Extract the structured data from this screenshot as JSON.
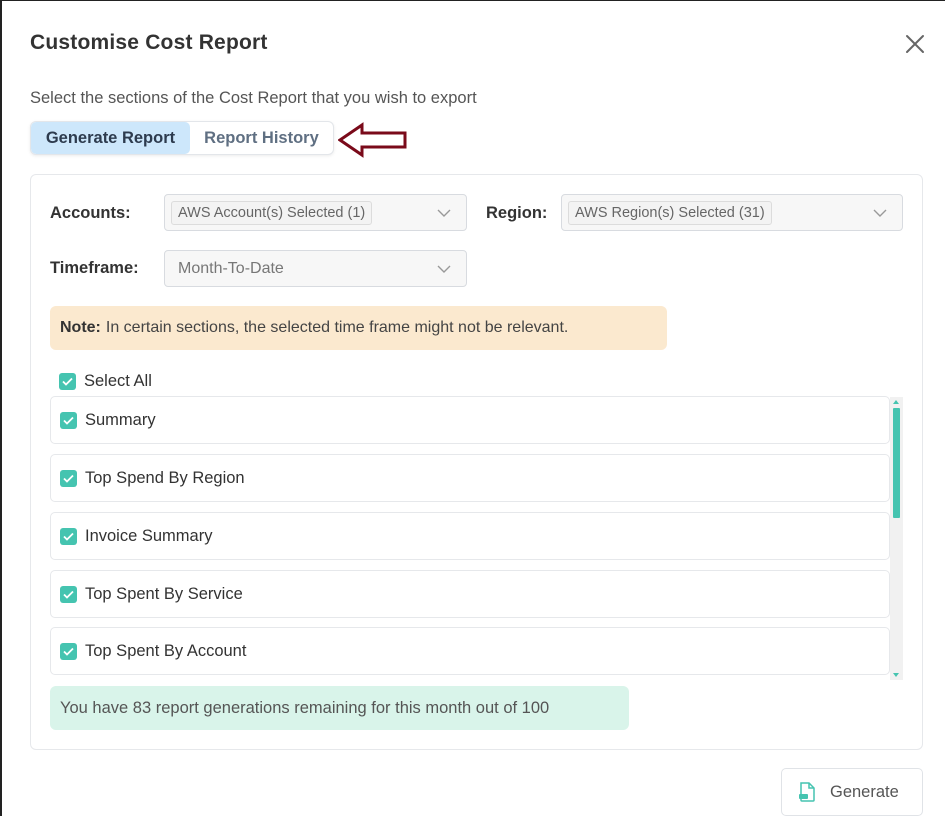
{
  "dialog": {
    "title": "Customise Cost Report",
    "subtitle": "Select the sections of the Cost Report that you wish to export"
  },
  "tabs": [
    {
      "label": "Generate Report",
      "active": true
    },
    {
      "label": "Report History",
      "active": false
    }
  ],
  "filters": {
    "accounts_label": "Accounts:",
    "accounts_value": "AWS Account(s) Selected (1)",
    "region_label": "Region:",
    "region_value": "AWS Region(s) Selected (31)",
    "timeframe_label": "Timeframe:",
    "timeframe_value": "Month-To-Date"
  },
  "note": {
    "prefix": "Note:",
    "text": "In certain sections, the selected time frame might not be relevant."
  },
  "select_all": {
    "label": "Select All",
    "checked": true
  },
  "sections": [
    {
      "label": "Summary",
      "checked": true
    },
    {
      "label": "Top Spend By Region",
      "checked": true
    },
    {
      "label": "Invoice Summary",
      "checked": true
    },
    {
      "label": "Top Spent By Service",
      "checked": true
    },
    {
      "label": "Top Spent By Account",
      "checked": true
    }
  ],
  "remaining_text": "You have 83 report generations remaining for this month out of 100",
  "actions": {
    "generate_label": "Generate"
  },
  "colors": {
    "accent": "#45c4b0",
    "tab_active_bg": "#cde7fb",
    "note_bg": "#fbe9cf",
    "remaining_bg": "#d9f4ea",
    "annotation_arrow": "#7a0a1a"
  }
}
